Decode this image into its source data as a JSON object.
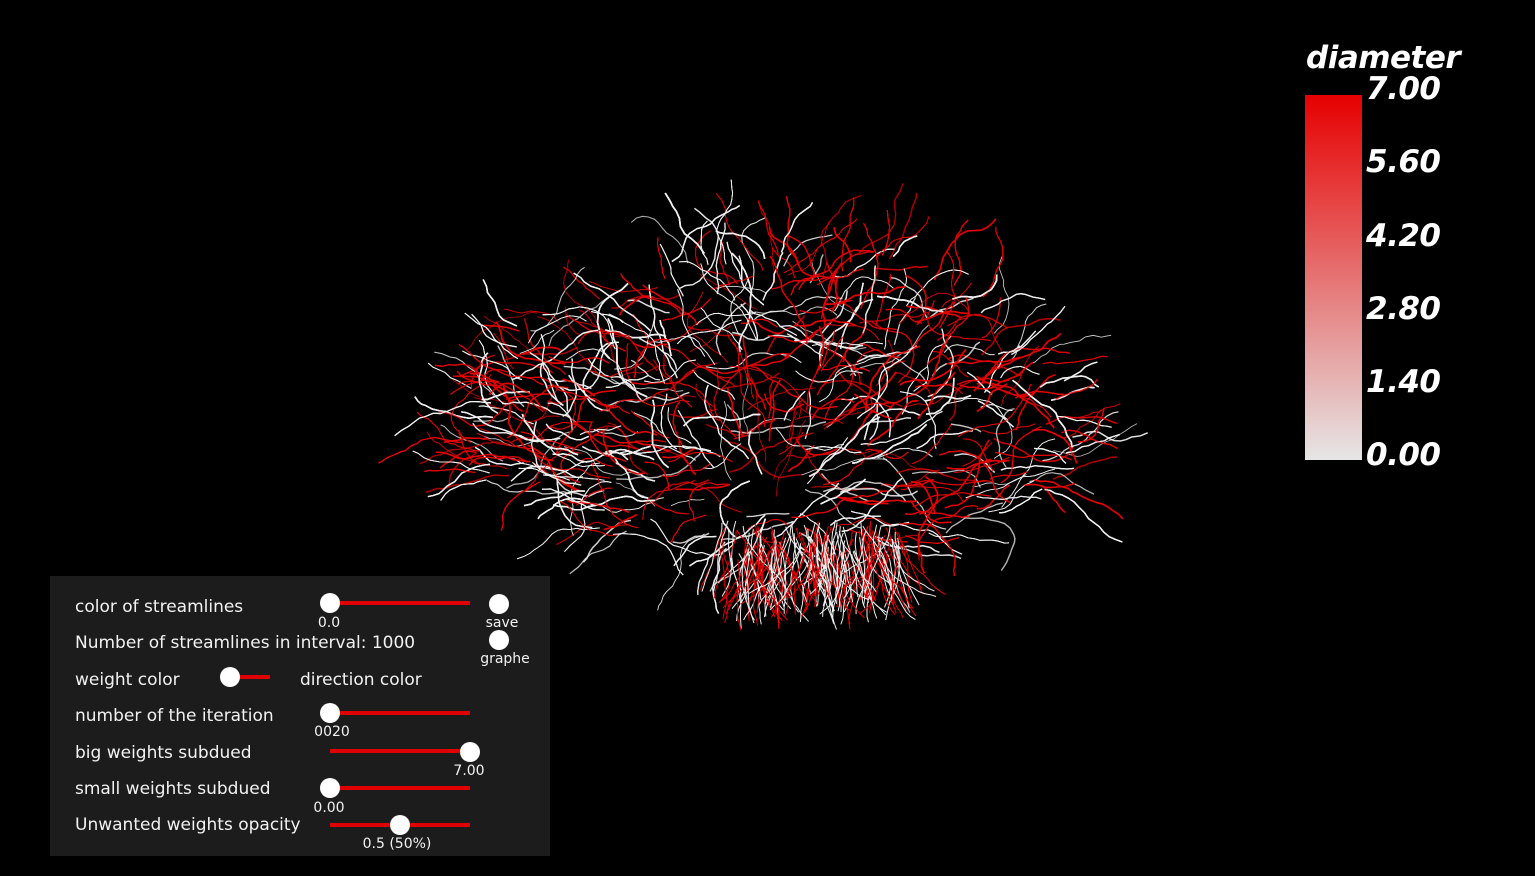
{
  "colorbar": {
    "title": "diameter",
    "ticks": [
      "7.00",
      "5.60",
      "4.20",
      "2.80",
      "1.40",
      "0.00"
    ],
    "color_high": "#e60000",
    "color_low": "#e6e6e6"
  },
  "visualization": {
    "subject": "brain white-matter streamlines",
    "colors": {
      "high": "#e60000",
      "low": "#f0f0f0",
      "background": "#000000"
    }
  },
  "panel": {
    "background": "#1c1c1c",
    "accent": "#e00000",
    "color_of_streamlines": {
      "label": "color of streamlines",
      "value": "0.0",
      "fraction": 0.0
    },
    "save_button": {
      "label": "save"
    },
    "graphe_button": {
      "label": "graphe"
    },
    "streamline_count": {
      "label": "Number of streamlines in interval: 1000"
    },
    "color_mode": {
      "left_label": "weight color",
      "right_label": "direction color",
      "fraction": 0.0
    },
    "iteration": {
      "label": "number of the iteration",
      "value": "0020",
      "fraction": 0.0
    },
    "big_weights": {
      "label": "big weights subdued",
      "value": "7.00",
      "fraction": 1.0
    },
    "small_weights": {
      "label": "small weights subdued",
      "value": "0.00",
      "fraction": 0.0
    },
    "unwanted_opacity": {
      "label": "Unwanted weights opacity",
      "value": "0.5 (50%)",
      "fraction": 0.5
    }
  }
}
